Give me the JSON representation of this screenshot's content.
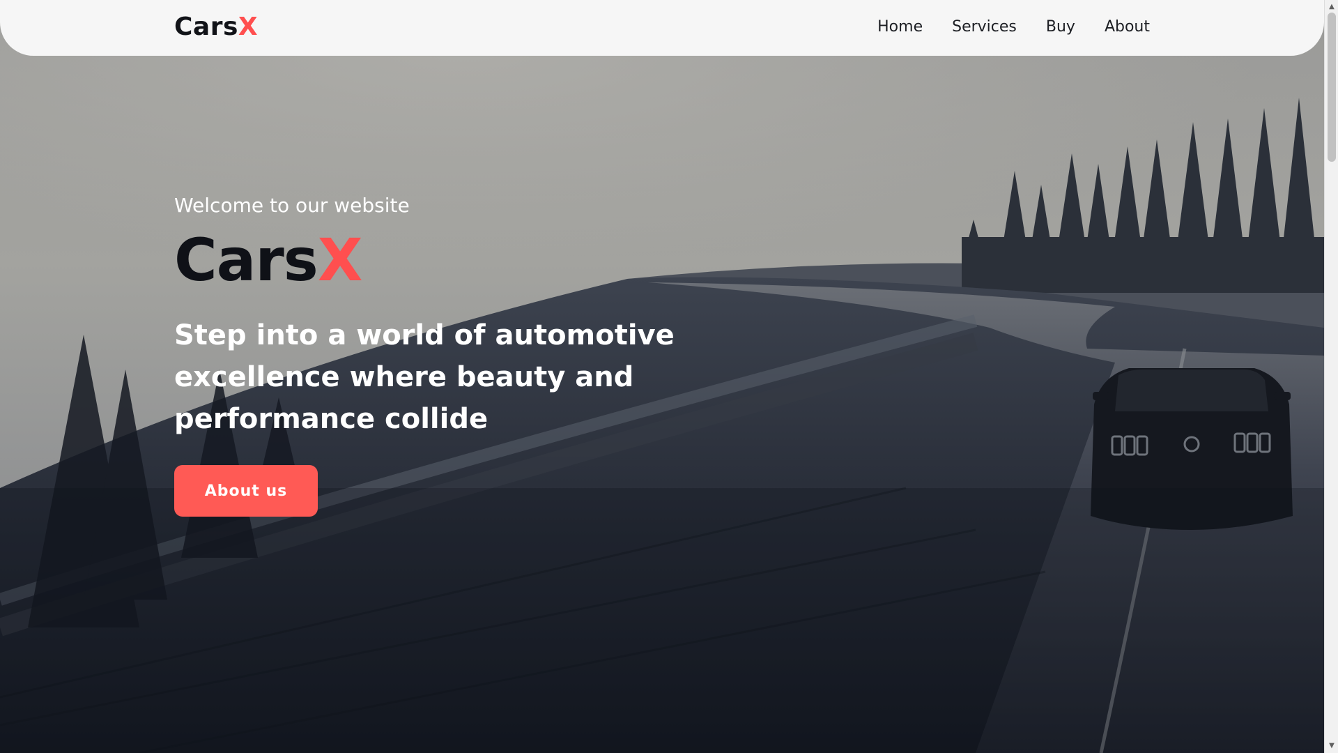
{
  "brand": {
    "name": "Cars",
    "accent_letter": "X",
    "accent_color": "#ff4f4f"
  },
  "nav": {
    "items": [
      {
        "label": "Home"
      },
      {
        "label": "Services"
      },
      {
        "label": "Buy"
      },
      {
        "label": "About"
      }
    ]
  },
  "hero": {
    "welcome": "Welcome to our website",
    "title": "Cars",
    "title_accent": "X",
    "tagline": "Step into a world of automotive excellence where beauty and performance collide",
    "cta_label": "About us",
    "cta_color": "#ff5a55",
    "background": "foggy mountain road with car"
  }
}
